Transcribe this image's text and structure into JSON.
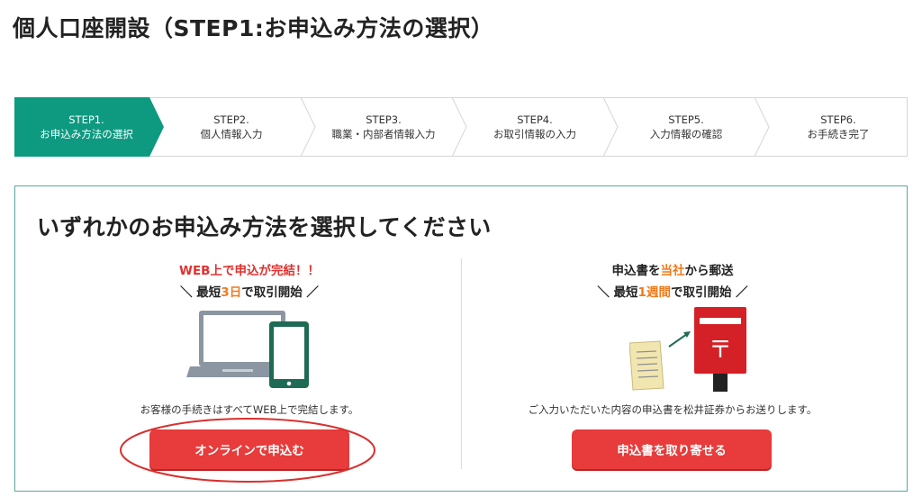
{
  "page": {
    "title": "個人口座開設（STEP1:お申込み方法の選択）"
  },
  "stepper": {
    "steps": [
      {
        "num": "STEP1.",
        "label": "お申込み方法の選択",
        "active": true
      },
      {
        "num": "STEP2.",
        "label": "個人情報入力",
        "active": false
      },
      {
        "num": "STEP3.",
        "label": "職業・内部者情報入力",
        "active": false
      },
      {
        "num": "STEP4.",
        "label": "お取引情報の入力",
        "active": false
      },
      {
        "num": "STEP5.",
        "label": "入力情報の確認",
        "active": false
      },
      {
        "num": "STEP6.",
        "label": "お手続き完了",
        "active": false
      }
    ]
  },
  "panel": {
    "heading": "いずれかのお申込み方法を選択してください"
  },
  "online": {
    "headline": "WEB上で申込が完結！！",
    "sub_prefix": "＼ 最短",
    "sub_highlight": "3日",
    "sub_suffix": "で取引開始 ／",
    "description": "お客様の手続きはすべてWEB上で完結します。",
    "button_label": "オンラインで申込む",
    "illustration_icon": "laptop-and-tablet-icon"
  },
  "mail": {
    "headline_prefix": "申込書を",
    "headline_highlight": "当社",
    "headline_suffix": "から郵送",
    "sub_prefix": "＼ 最短",
    "sub_highlight": "1週間",
    "sub_suffix": "で取引開始 ／",
    "description": "ご入力いただいた内容の申込書を松井証券からお送りします。",
    "button_label": "申込書を取り寄せる",
    "illustration_icon": "postbox-and-letter-icon"
  },
  "colors": {
    "active_step": "#0e9a80",
    "accent_red": "#e0312f",
    "accent_orange": "#f07a1a",
    "button": "#e83b3b",
    "panel_border": "#5aaaa0",
    "annotation_circle": "#d8302e"
  }
}
